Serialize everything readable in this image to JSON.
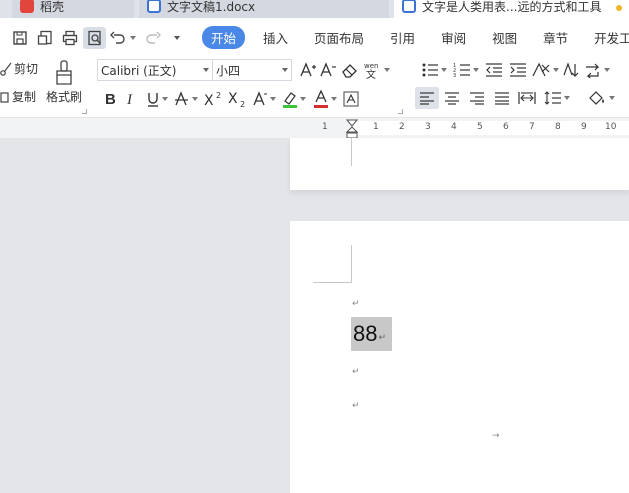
{
  "tabs": [
    {
      "label": "稻壳"
    },
    {
      "label": "文字文稿1.docx"
    },
    {
      "label": "文字是人类用表...远的方式和工具"
    }
  ],
  "menu": {
    "items": [
      "开始",
      "插入",
      "页面布局",
      "引用",
      "审阅",
      "视图",
      "章节",
      "开发工具"
    ]
  },
  "clipboard": {
    "cut": "剪切",
    "copy": "复制",
    "format_painter": "格式刷"
  },
  "font": {
    "name": "Calibri (正文)",
    "size": "小四"
  },
  "ruler": {
    "numbers": [
      "1",
      "1",
      "2",
      "3",
      "4",
      "5",
      "6",
      "7",
      "8",
      "9",
      "10"
    ]
  },
  "document": {
    "line_text": "88",
    "para_mark": "↵",
    "arrow_mark": "→"
  },
  "colors": {
    "accent": "#4a88e8",
    "highlight": "#c8c8c8",
    "font_color_bar": "#d62f2f",
    "highlight_bar": "#3cc53c"
  }
}
